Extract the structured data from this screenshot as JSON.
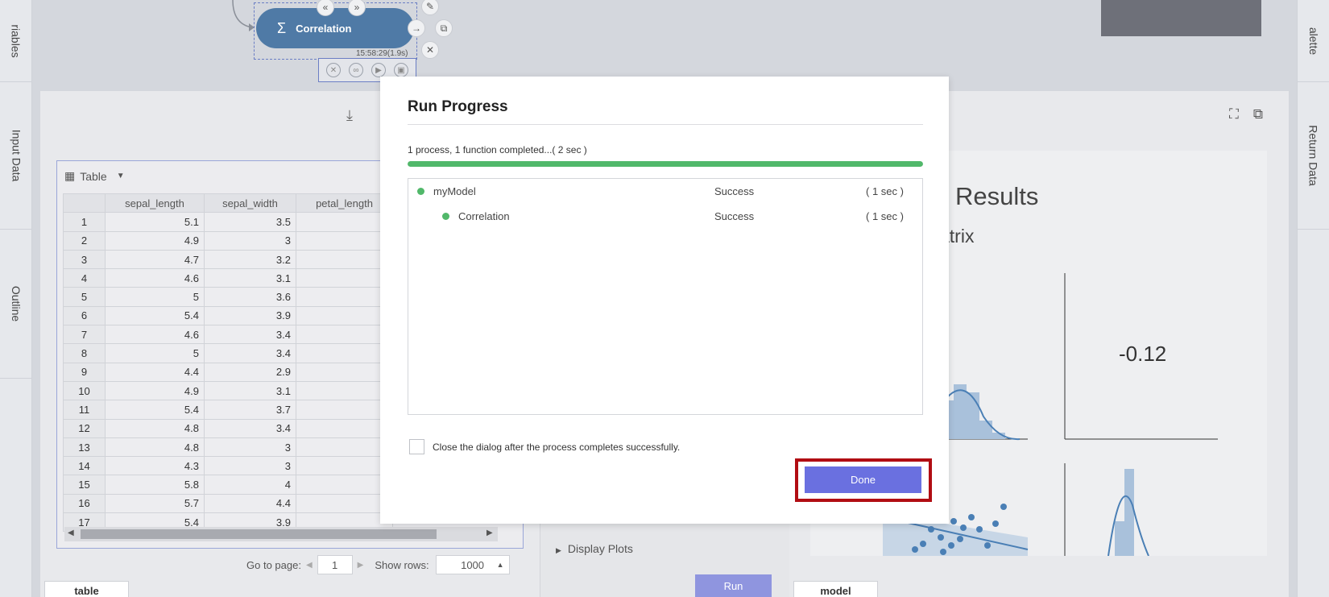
{
  "rails": {
    "left_tabs": [
      "riables",
      "Input Data",
      "Outline"
    ],
    "right_tabs": [
      "alette",
      "Return Data"
    ]
  },
  "node": {
    "label": "Correlation",
    "sigma": "Σ",
    "timestamp": "15:58:29(1.9s)"
  },
  "table": {
    "view_label": "Table",
    "columns": [
      "sepal_length",
      "sepal_width",
      "petal_length"
    ],
    "rows": [
      [
        "1",
        "5.1",
        "3.5"
      ],
      [
        "2",
        "4.9",
        "3"
      ],
      [
        "3",
        "4.7",
        "3.2"
      ],
      [
        "4",
        "4.6",
        "3.1"
      ],
      [
        "5",
        "5",
        "3.6"
      ],
      [
        "6",
        "5.4",
        "3.9"
      ],
      [
        "7",
        "4.6",
        "3.4"
      ],
      [
        "8",
        "5",
        "3.4"
      ],
      [
        "9",
        "4.4",
        "2.9"
      ],
      [
        "10",
        "4.9",
        "3.1"
      ],
      [
        "11",
        "5.4",
        "3.7"
      ],
      [
        "12",
        "4.8",
        "3.4"
      ],
      [
        "13",
        "4.8",
        "3"
      ],
      [
        "14",
        "4.3",
        "3"
      ],
      [
        "15",
        "5.8",
        "4"
      ],
      [
        "16",
        "5.7",
        "4.4"
      ],
      [
        "17",
        "5.4",
        "3.9"
      ]
    ]
  },
  "pager": {
    "go_to_label": "Go to page:",
    "page": "1",
    "show_rows_label": "Show rows:",
    "rows_value": "1000"
  },
  "bottom_tabs": {
    "left": "table",
    "right": "model"
  },
  "middle": {
    "display_plots": "Display Plots",
    "run_label": "Run"
  },
  "results": {
    "title": "Results",
    "subtitle": "atrix",
    "corr_value": "-0.12"
  },
  "dialog": {
    "title": "Run Progress",
    "status_text": "1 process, 1 function completed...( 2 sec )",
    "progress_fraction": 1.0,
    "processes": [
      {
        "name": "myModel",
        "status": "Success",
        "time": "( 1 sec )",
        "indent": 0
      },
      {
        "name": "Correlation",
        "status": "Success",
        "time": "( 1 sec )",
        "indent": 1
      }
    ],
    "close_checkbox_label": "Close the dialog after the process completes successfully.",
    "done_label": "Done"
  },
  "colors": {
    "node": "#4f7aa6",
    "success_dot": "#51b86a",
    "progress": "#51b86a",
    "done_button": "#6a70e0",
    "highlight": "#b10d13"
  }
}
